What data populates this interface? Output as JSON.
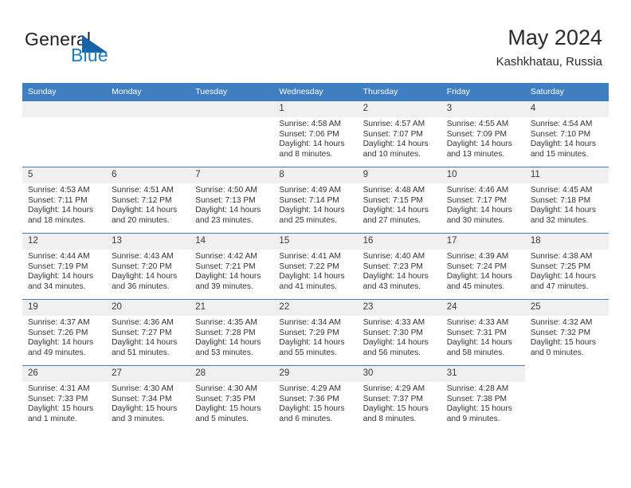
{
  "brand": {
    "word1": "General",
    "word2": "Blue",
    "logo_icon": "triangle-icon",
    "accent_color": "#1763a8",
    "blue_text_color": "#1f7bc1"
  },
  "header": {
    "title": "May 2024",
    "subtitle": "Kashkhatau, Russia"
  },
  "calendar": {
    "header_bg": "#3f7fc1",
    "daynum_bg": "#f0f0f0",
    "weekdays": [
      "Sunday",
      "Monday",
      "Tuesday",
      "Wednesday",
      "Thursday",
      "Friday",
      "Saturday"
    ],
    "weeks": [
      [
        {
          "day": "",
          "lines": []
        },
        {
          "day": "",
          "lines": []
        },
        {
          "day": "",
          "lines": []
        },
        {
          "day": "1",
          "lines": [
            "Sunrise: 4:58 AM",
            "Sunset: 7:06 PM",
            "Daylight: 14 hours",
            "and 8 minutes."
          ]
        },
        {
          "day": "2",
          "lines": [
            "Sunrise: 4:57 AM",
            "Sunset: 7:07 PM",
            "Daylight: 14 hours",
            "and 10 minutes."
          ]
        },
        {
          "day": "3",
          "lines": [
            "Sunrise: 4:55 AM",
            "Sunset: 7:09 PM",
            "Daylight: 14 hours",
            "and 13 minutes."
          ]
        },
        {
          "day": "4",
          "lines": [
            "Sunrise: 4:54 AM",
            "Sunset: 7:10 PM",
            "Daylight: 14 hours",
            "and 15 minutes."
          ]
        }
      ],
      [
        {
          "day": "5",
          "lines": [
            "Sunrise: 4:53 AM",
            "Sunset: 7:11 PM",
            "Daylight: 14 hours",
            "and 18 minutes."
          ]
        },
        {
          "day": "6",
          "lines": [
            "Sunrise: 4:51 AM",
            "Sunset: 7:12 PM",
            "Daylight: 14 hours",
            "and 20 minutes."
          ]
        },
        {
          "day": "7",
          "lines": [
            "Sunrise: 4:50 AM",
            "Sunset: 7:13 PM",
            "Daylight: 14 hours",
            "and 23 minutes."
          ]
        },
        {
          "day": "8",
          "lines": [
            "Sunrise: 4:49 AM",
            "Sunset: 7:14 PM",
            "Daylight: 14 hours",
            "and 25 minutes."
          ]
        },
        {
          "day": "9",
          "lines": [
            "Sunrise: 4:48 AM",
            "Sunset: 7:15 PM",
            "Daylight: 14 hours",
            "and 27 minutes."
          ]
        },
        {
          "day": "10",
          "lines": [
            "Sunrise: 4:46 AM",
            "Sunset: 7:17 PM",
            "Daylight: 14 hours",
            "and 30 minutes."
          ]
        },
        {
          "day": "11",
          "lines": [
            "Sunrise: 4:45 AM",
            "Sunset: 7:18 PM",
            "Daylight: 14 hours",
            "and 32 minutes."
          ]
        }
      ],
      [
        {
          "day": "12",
          "lines": [
            "Sunrise: 4:44 AM",
            "Sunset: 7:19 PM",
            "Daylight: 14 hours",
            "and 34 minutes."
          ]
        },
        {
          "day": "13",
          "lines": [
            "Sunrise: 4:43 AM",
            "Sunset: 7:20 PM",
            "Daylight: 14 hours",
            "and 36 minutes."
          ]
        },
        {
          "day": "14",
          "lines": [
            "Sunrise: 4:42 AM",
            "Sunset: 7:21 PM",
            "Daylight: 14 hours",
            "and 39 minutes."
          ]
        },
        {
          "day": "15",
          "lines": [
            "Sunrise: 4:41 AM",
            "Sunset: 7:22 PM",
            "Daylight: 14 hours",
            "and 41 minutes."
          ]
        },
        {
          "day": "16",
          "lines": [
            "Sunrise: 4:40 AM",
            "Sunset: 7:23 PM",
            "Daylight: 14 hours",
            "and 43 minutes."
          ]
        },
        {
          "day": "17",
          "lines": [
            "Sunrise: 4:39 AM",
            "Sunset: 7:24 PM",
            "Daylight: 14 hours",
            "and 45 minutes."
          ]
        },
        {
          "day": "18",
          "lines": [
            "Sunrise: 4:38 AM",
            "Sunset: 7:25 PM",
            "Daylight: 14 hours",
            "and 47 minutes."
          ]
        }
      ],
      [
        {
          "day": "19",
          "lines": [
            "Sunrise: 4:37 AM",
            "Sunset: 7:26 PM",
            "Daylight: 14 hours",
            "and 49 minutes."
          ]
        },
        {
          "day": "20",
          "lines": [
            "Sunrise: 4:36 AM",
            "Sunset: 7:27 PM",
            "Daylight: 14 hours",
            "and 51 minutes."
          ]
        },
        {
          "day": "21",
          "lines": [
            "Sunrise: 4:35 AM",
            "Sunset: 7:28 PM",
            "Daylight: 14 hours",
            "and 53 minutes."
          ]
        },
        {
          "day": "22",
          "lines": [
            "Sunrise: 4:34 AM",
            "Sunset: 7:29 PM",
            "Daylight: 14 hours",
            "and 55 minutes."
          ]
        },
        {
          "day": "23",
          "lines": [
            "Sunrise: 4:33 AM",
            "Sunset: 7:30 PM",
            "Daylight: 14 hours",
            "and 56 minutes."
          ]
        },
        {
          "day": "24",
          "lines": [
            "Sunrise: 4:33 AM",
            "Sunset: 7:31 PM",
            "Daylight: 14 hours",
            "and 58 minutes."
          ]
        },
        {
          "day": "25",
          "lines": [
            "Sunrise: 4:32 AM",
            "Sunset: 7:32 PM",
            "Daylight: 15 hours",
            "and 0 minutes."
          ]
        }
      ],
      [
        {
          "day": "26",
          "lines": [
            "Sunrise: 4:31 AM",
            "Sunset: 7:33 PM",
            "Daylight: 15 hours",
            "and 1 minute."
          ]
        },
        {
          "day": "27",
          "lines": [
            "Sunrise: 4:30 AM",
            "Sunset: 7:34 PM",
            "Daylight: 15 hours",
            "and 3 minutes."
          ]
        },
        {
          "day": "28",
          "lines": [
            "Sunrise: 4:30 AM",
            "Sunset: 7:35 PM",
            "Daylight: 15 hours",
            "and 5 minutes."
          ]
        },
        {
          "day": "29",
          "lines": [
            "Sunrise: 4:29 AM",
            "Sunset: 7:36 PM",
            "Daylight: 15 hours",
            "and 6 minutes."
          ]
        },
        {
          "day": "30",
          "lines": [
            "Sunrise: 4:29 AM",
            "Sunset: 7:37 PM",
            "Daylight: 15 hours",
            "and 8 minutes."
          ]
        },
        {
          "day": "31",
          "lines": [
            "Sunrise: 4:28 AM",
            "Sunset: 7:38 PM",
            "Daylight: 15 hours",
            "and 9 minutes."
          ]
        }
      ]
    ]
  }
}
